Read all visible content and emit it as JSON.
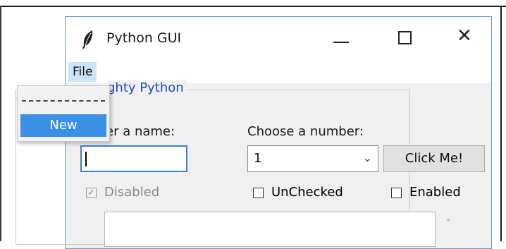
{
  "window": {
    "title": "Python GUI",
    "minimize_glyph": "—",
    "close_glyph": "✕"
  },
  "menubar": {
    "file_label": "File"
  },
  "file_menu": {
    "items": [
      {
        "label": "New"
      }
    ]
  },
  "labelframe": {
    "title": "ghty Python"
  },
  "form": {
    "name_label": "er a name:",
    "name_value": "",
    "number_label": "Choose a number:",
    "number_value": "1",
    "click_button_label": "Click Me!"
  },
  "checkboxes": {
    "disabled_label": "Disabled",
    "unchecked_label": "UnChecked",
    "enabled_label": "Enabled",
    "check_glyph": "✓"
  },
  "scrolltext": {
    "up_arrow": "˄"
  },
  "colors": {
    "accent": "#3a8fe6",
    "frame_title": "#1f4bb4",
    "file_highlight": "#cde3f7"
  }
}
